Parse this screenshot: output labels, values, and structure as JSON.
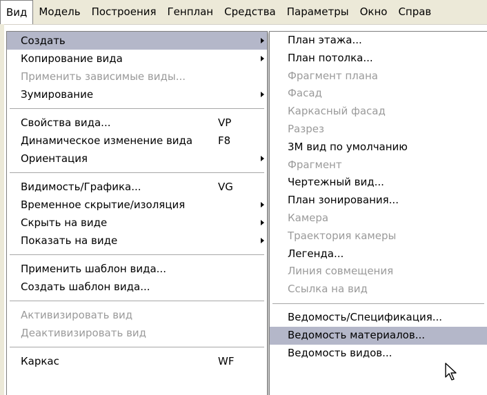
{
  "menubar": [
    "Вид",
    "Модель",
    "Построения",
    "Генплан",
    "Средства",
    "Параметры",
    "Окно",
    "Справ"
  ],
  "menu1": {
    "g1": [
      {
        "label": "Создать",
        "submenu": true,
        "highlight": true
      },
      {
        "label": "Копирование вида",
        "submenu": true
      },
      {
        "label": "Применить зависимые виды...",
        "disabled": true
      },
      {
        "label": "Зумирование",
        "submenu": true
      }
    ],
    "g2": [
      {
        "label": "Свойства вида...",
        "shortcut": "VP"
      },
      {
        "label": "Динамическое изменение вида",
        "shortcut": "F8"
      },
      {
        "label": "Ориентация",
        "submenu": true
      }
    ],
    "g3": [
      {
        "label": "Видимость/Графика...",
        "shortcut": "VG"
      },
      {
        "label": "Временное скрытие/изоляция",
        "submenu": true
      },
      {
        "label": "Скрыть на виде",
        "submenu": true
      },
      {
        "label": "Показать на виде",
        "submenu": true
      }
    ],
    "g4": [
      {
        "label": "Применить шаблон вида..."
      },
      {
        "label": "Создать шаблон вида..."
      }
    ],
    "g5": [
      {
        "label": "Активизировать вид",
        "disabled": true
      },
      {
        "label": "Деактивизировать вид",
        "disabled": true
      }
    ],
    "g6": [
      {
        "label": "Каркас",
        "shortcut": "WF"
      }
    ]
  },
  "menu2": {
    "g1": [
      {
        "label": "План этажа..."
      },
      {
        "label": "План потолка..."
      },
      {
        "label": "Фрагмент плана",
        "disabled": true
      },
      {
        "label": "Фасад",
        "disabled": true
      },
      {
        "label": "Каркасный фасад",
        "disabled": true
      },
      {
        "label": "Разрез",
        "disabled": true
      },
      {
        "label": "3М вид по умолчанию"
      },
      {
        "label": "Фрагмент",
        "disabled": true
      },
      {
        "label": "Чертежный вид..."
      },
      {
        "label": "План зонирования..."
      },
      {
        "label": "Камера",
        "disabled": true
      },
      {
        "label": "Траектория камеры",
        "disabled": true
      },
      {
        "label": "Легенда..."
      },
      {
        "label": "Линия совмещения",
        "disabled": true
      },
      {
        "label": "Ссылка на вид",
        "disabled": true
      }
    ],
    "g2": [
      {
        "label": "Ведомость/Спецификация..."
      },
      {
        "label": "Ведомость материалов...",
        "highlight": true
      },
      {
        "label": "Ведомость видов..."
      }
    ]
  },
  "colors": {
    "highlight": "#b4b7c9",
    "disabled": "#9a9a9a",
    "menubar": "#ece9d8"
  },
  "icons": {
    "cursor": "arrow-pointer-icon",
    "submenu": "submenu-arrow-icon"
  }
}
